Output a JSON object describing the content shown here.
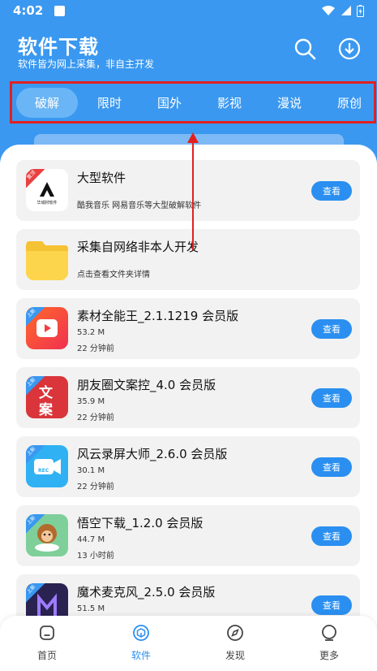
{
  "status": {
    "time": "4:02"
  },
  "header": {
    "title": "软件下载",
    "subtitle": "软件皆为网上采集，非自主开发"
  },
  "tabs": [
    {
      "label": "破解",
      "active": true
    },
    {
      "label": "限时",
      "active": false
    },
    {
      "label": "国外",
      "active": false
    },
    {
      "label": "影视",
      "active": false
    },
    {
      "label": "漫说",
      "active": false
    },
    {
      "label": "原创",
      "active": false
    }
  ],
  "items": [
    {
      "title": "大型软件",
      "desc": "酷我音乐 网易音乐等大型破解软件",
      "badge": "置顶",
      "button": "查看",
      "icon_text": "华城材软件"
    },
    {
      "title": "采集自网络非本人开发",
      "desc": "点击查看文件夹详情"
    },
    {
      "title": "素材全能王_2.1.1219 会员版",
      "size": "53.2 M",
      "time": "22 分钟前",
      "badge": "上新",
      "button": "查看"
    },
    {
      "title": "朋友圈文案控_4.0 会员版",
      "size": "35.9 M",
      "time": "22 分钟前",
      "badge": "上新",
      "button": "查看",
      "icon_text1": "文",
      "icon_text2": "案"
    },
    {
      "title": "风云录屏大师_2.6.0 会员版",
      "size": "30.1 M",
      "time": "22 分钟前",
      "badge": "上新",
      "button": "查看",
      "icon_text": "REC"
    },
    {
      "title": "悟空下载_1.2.0 会员版",
      "size": "44.7 M",
      "time": "13 小时前",
      "badge": "上新",
      "button": "查看"
    },
    {
      "title": "魔术麦克风_2.5.0 会员版",
      "size": "51.5 M",
      "badge": "上新",
      "button": "查看"
    }
  ],
  "nav": [
    {
      "label": "首页",
      "icon": "home-icon"
    },
    {
      "label": "软件",
      "icon": "software-icon"
    },
    {
      "label": "发现",
      "icon": "compass-icon"
    },
    {
      "label": "更多",
      "icon": "more-icon"
    }
  ],
  "colors": {
    "primary": "#3a98f0",
    "button": "#2a8ff0",
    "highlight": "#e32020"
  }
}
